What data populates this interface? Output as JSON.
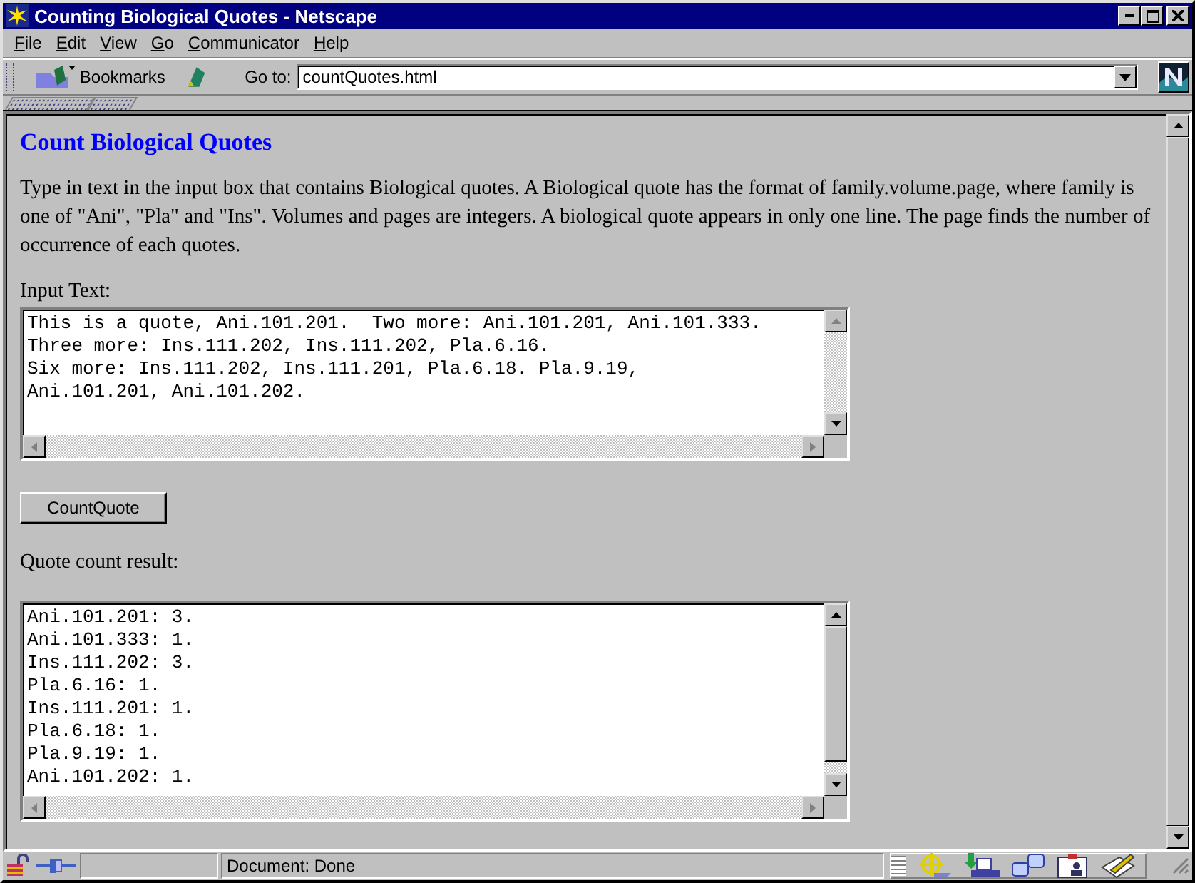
{
  "window": {
    "title": "Counting Biological Quotes - Netscape"
  },
  "menu": [
    "File",
    "Edit",
    "View",
    "Go",
    "Communicator",
    "Help"
  ],
  "toolbar": {
    "bookmarks": "Bookmarks",
    "goto_label": "Go to:",
    "address": "countQuotes.html"
  },
  "page": {
    "heading": "Count Biological Quotes",
    "intro": "Type in text in the input box that contains Biological quotes. A Biological quote has the format of family.volume.page, where family is one of \"Ani\", \"Pla\" and \"Ins\". Volumes and pages are integers. A biological quote appears in only one line. The page finds the number of occurrence of each quotes.",
    "input_label": "Input Text:",
    "input_lines": [
      "This is a quote, Ani.101.201.  Two more: Ani.101.201, Ani.101.333.",
      "Three more: Ins.111.202, Ins.111.202, Pla.6.16.",
      "Six more: Ins.111.202, Ins.111.201, Pla.6.18. Pla.9.19,",
      "Ani.101.201, Ani.101.202."
    ],
    "button": "CountQuote",
    "result_label": "Quote count result:",
    "result_lines": [
      "Ani.101.201: 3.",
      "Ani.101.333: 1.",
      "Ins.111.202: 3.",
      "Pla.6.16: 1.",
      "Ins.111.201: 1.",
      "Pla.6.18: 1.",
      "Pla.9.19: 1.",
      "Ani.101.202: 1."
    ]
  },
  "status_bar": {
    "text": "Document: Done"
  }
}
